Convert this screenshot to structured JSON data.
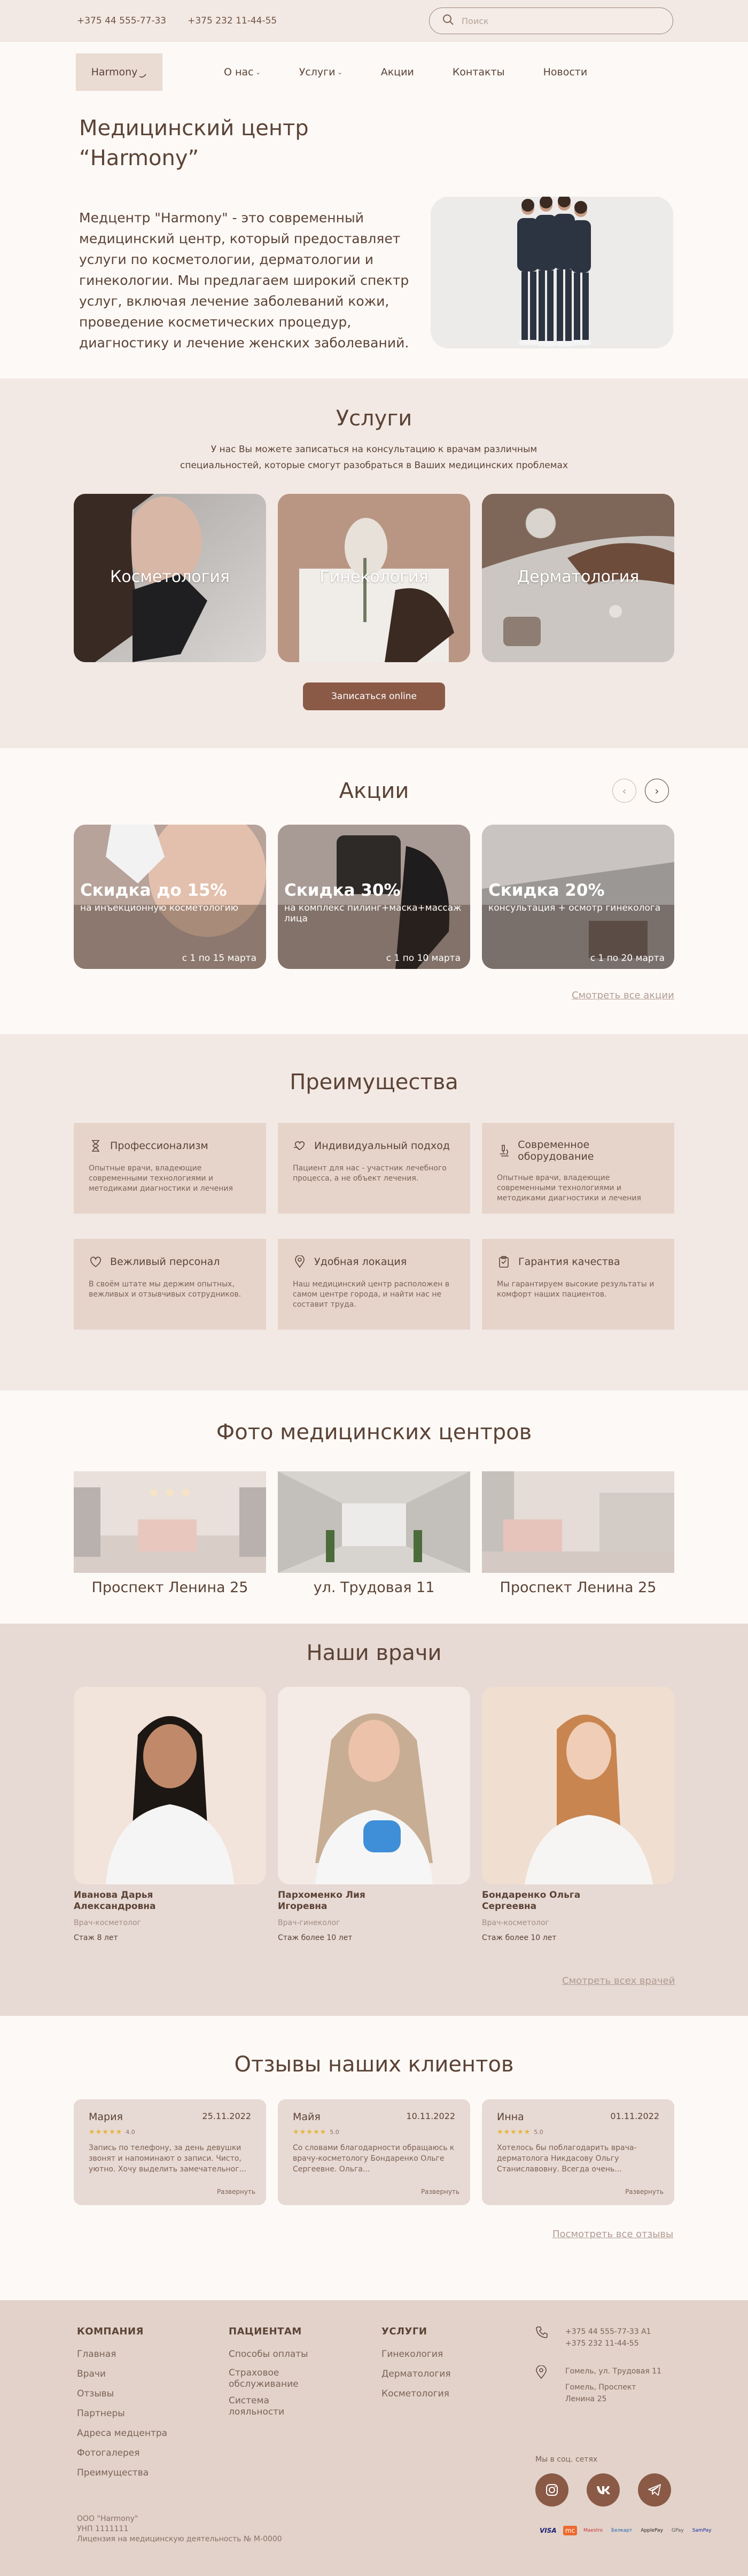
{
  "topbar": {
    "phone1": "+375 44 555-77-33",
    "phone2": "+375 232 11-44-55",
    "search_placeholder": "Поиск"
  },
  "nav": {
    "logo": "Harmony",
    "items": [
      {
        "label": "О нас",
        "has_dropdown": true
      },
      {
        "label": "Услуги",
        "has_dropdown": true
      },
      {
        "label": "Акции",
        "has_dropdown": false
      },
      {
        "label": "Контакты",
        "has_dropdown": false
      },
      {
        "label": "Новости",
        "has_dropdown": false
      }
    ]
  },
  "hero": {
    "title_line1": "Медицинский центр",
    "title_line2": "“Harmony”",
    "text": "Медцентр \"Harmony\" - это современный медицинский центр, который предоставляет услуги по косметологии, дерматологии и гинекологии. Мы предлагаем широкий спектр услуг, включая лечение заболеваний кожи, проведение косметических процедур, диагностику и лечение женских заболеваний."
  },
  "services": {
    "title": "Услуги",
    "subtitle_line1": "У нас Вы можете записаться на консультацию к врачам различным",
    "subtitle_line2": "специальностей, которые смогут разобраться в Ваших медицинских проблемах",
    "cards": [
      {
        "label": "Косметология"
      },
      {
        "label": "Гинекология"
      },
      {
        "label": "Дерматология"
      }
    ],
    "button": "Записаться online"
  },
  "promos": {
    "title": "Акции",
    "cards": [
      {
        "title": "Скидка до 15%",
        "desc": "на инъекционную косметологию",
        "date": "с 1 по 15 марта"
      },
      {
        "title": "Скидка 30%",
        "desc": "на комплекс пилинг+маска+массаж лица",
        "date": "с 1 по 10 марта"
      },
      {
        "title": "Скидка 20%",
        "desc": "консультация + осмотр гинеколога",
        "date": "с 1 по 20 марта"
      }
    ],
    "see_all": "Смотреть все акции"
  },
  "advantages": {
    "title": "Преимущества",
    "items": [
      {
        "icon": "hourglass-icon",
        "title": "Профессионализм",
        "text": "Опытные врачи, владеющие современными технологиями и методиками диагностики и лечения"
      },
      {
        "icon": "heart-hand-icon",
        "title": "Индивидуальный подход",
        "text": "Пациент для нас - участник лечебного процесса, а не объект лечения."
      },
      {
        "icon": "microscope-icon",
        "title": "Современное оборудование",
        "text": "Опытные врачи, владеющие современными технологиями и методиками диагностики и лечения"
      },
      {
        "icon": "heart-icon",
        "title": "Вежливый персонал",
        "text": "В своём штате мы держим опытных, вежливых и отзывчивых сотрудников."
      },
      {
        "icon": "location-icon",
        "title": "Удобная локация",
        "text": "Наш медицинский центр расположен в самом центре города, и найти нас не составит труда."
      },
      {
        "icon": "clipboard-icon",
        "title": "Гарантия качества",
        "text": "Мы гарантируем высокие результаты и комфорт наших пациентов."
      }
    ]
  },
  "photos": {
    "title": "Фото медицинских центров",
    "items": [
      {
        "caption": "Проспект Ленина 25"
      },
      {
        "caption": "ул. Трудовая 11"
      },
      {
        "caption": "Проспект Ленина 25"
      }
    ]
  },
  "doctors": {
    "title": "Наши врачи",
    "items": [
      {
        "name1": "Иванова Дарья",
        "name2": "Александровна",
        "role": "Врач-косметолог",
        "exp": "Стаж 8 лет"
      },
      {
        "name1": "Пархоменко Лия",
        "name2": "Игоревна",
        "role": "Врач-гинеколог",
        "exp": "Стаж более 10 лет"
      },
      {
        "name1": "Бондаренко Ольга",
        "name2": "Сергеевна",
        "role": "Врач-косметолог",
        "exp": "Стаж более 10 лет"
      }
    ],
    "see_all": "Смотреть всех врачей"
  },
  "reviews": {
    "title": "Отзывы наших клиентов",
    "items": [
      {
        "name": "Мария",
        "date": "25.11.2022",
        "rating": "4.0",
        "text": "Запись по телефону, за день девушки звонят и напоминают о записи. Чисто, уютно. Хочу выделить замечательног...",
        "more": "Развернуть"
      },
      {
        "name": "Майя",
        "date": "10.11.2022",
        "rating": "5.0",
        "text": "Со словами благодарности обращаюсь к врачу-косметологу Бондаренко Ольге Сергеевне. Ольга...",
        "more": "Развернуть"
      },
      {
        "name": "Инна",
        "date": "01.11.2022",
        "rating": "5.0",
        "text": "Хотелось бы поблагодарить врача-дерматолога Никдасову Ольгу Станиславовну. Всегда очень...",
        "more": "Развернуть"
      }
    ],
    "see_all": "Посмотреть все отзывы"
  },
  "footer": {
    "col1": {
      "title": "КОМПАНИЯ",
      "links": [
        "Главная",
        "Врачи",
        "Отзывы",
        "Партнеры",
        "Адреса медцентра",
        "Фотогалерея",
        "Преимущества"
      ]
    },
    "col2": {
      "title": "ПАЦИЕНТАМ",
      "links": [
        "Способы оплаты",
        "Страховое обслуживание",
        "Система лояльности"
      ]
    },
    "col3": {
      "title": "УСЛУГИ",
      "links": [
        "Гинекология",
        "Дерматология",
        "Косметология"
      ]
    },
    "phones": [
      "+375 44 555-77-33 А1",
      "+375 232 11-44-55"
    ],
    "address": [
      "Гомель, ул. Трудовая 11",
      "Гомель, Проспект",
      "Ленина 25"
    ],
    "social_label": "Мы в соц. сетях",
    "legal": [
      "ООО \"Harmony\"",
      "УНП 1111111",
      "Лицензия на медицинскую деятельность № М-0000"
    ],
    "payments": [
      "VISA",
      "mc",
      "Maestro",
      "Белкарт",
      "ApplePay",
      "GPay",
      "SamPay"
    ]
  }
}
